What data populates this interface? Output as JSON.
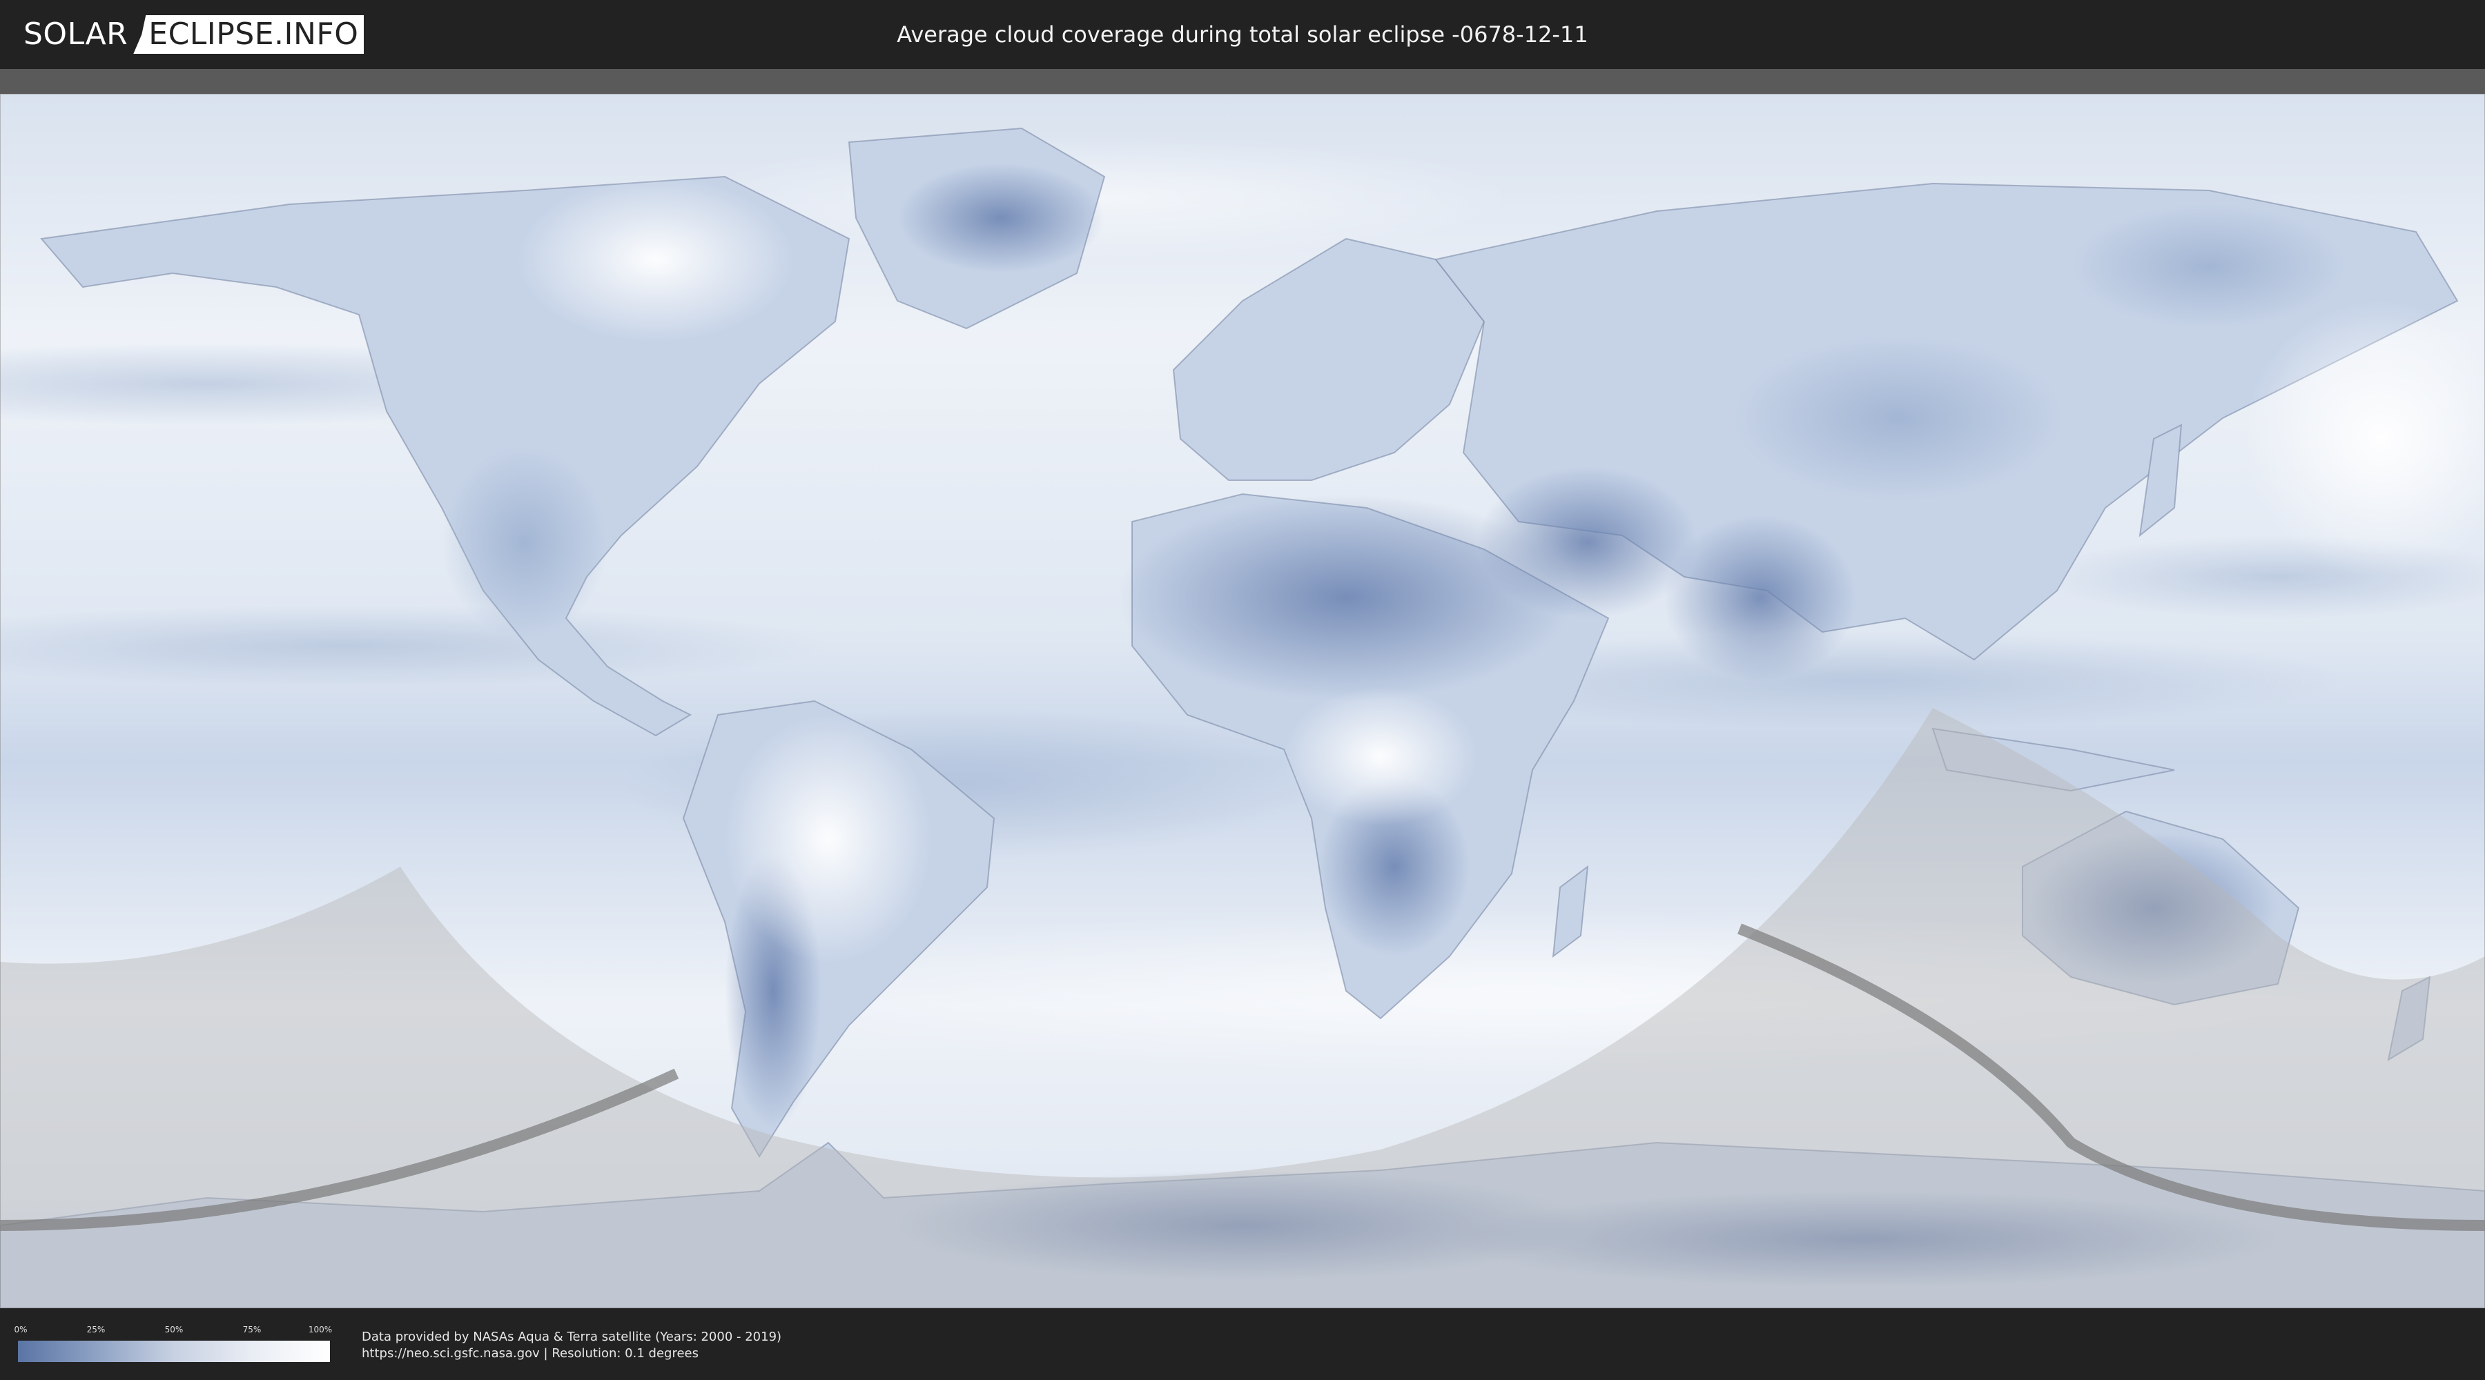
{
  "header": {
    "logo_left": "SOLAR",
    "logo_right": "ECLIPSE.INFO",
    "title": "Average cloud coverage during total solar eclipse -0678-12-11"
  },
  "legend": {
    "ticks": [
      "0%",
      "25%",
      "50%",
      "75%",
      "100%"
    ],
    "colors": {
      "low": "#5a74a5",
      "high": "#ffffff"
    }
  },
  "footer": {
    "credit_line1": "Data provided by NASAs Aqua & Terra satellite (Years: 2000 - 2019)",
    "credit_line2": "https://neo.sci.gsfc.nasa.gov | Resolution: 0.1 degrees"
  },
  "colors": {
    "background": "#222222",
    "ocean_cloud": "#e3eaf4",
    "dense_cloud": "#ffffff",
    "clear_sky": "#6a82b0",
    "night_shade": "#bdbdbd",
    "eclipse_path": "#7a7a7a"
  }
}
